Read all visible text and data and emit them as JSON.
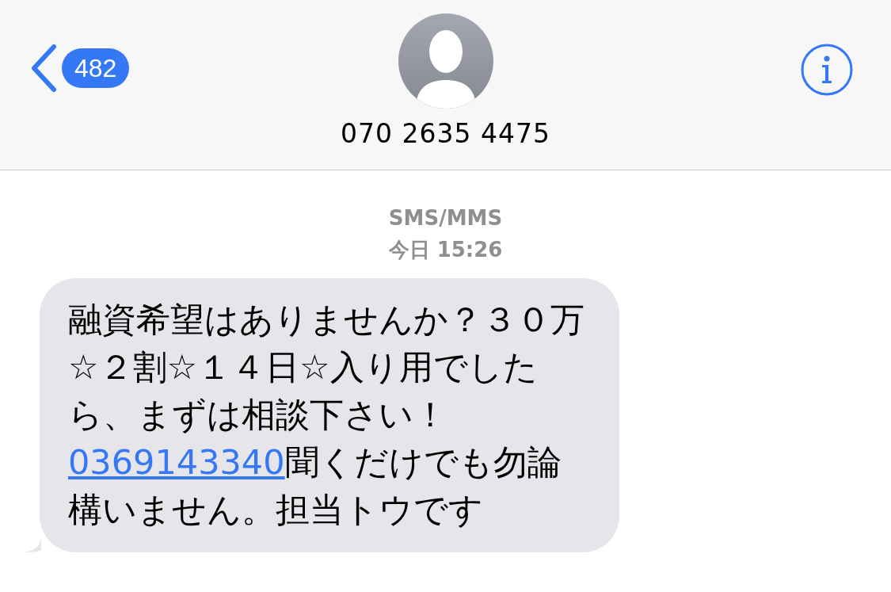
{
  "header": {
    "back_badge": "482",
    "contact": "070 2635 4475"
  },
  "conversation": {
    "service": "SMS/MMS",
    "timestamp": "今日 15:26",
    "messages": [
      {
        "kind": "incoming",
        "text_before": "融資希望はありませんか？３０万☆２割☆１４日☆入り用でしたら、まずは相談下さい！",
        "link": "0369143340",
        "text_after": "聞くだけでも勿論構いません。担当トウです"
      }
    ]
  }
}
